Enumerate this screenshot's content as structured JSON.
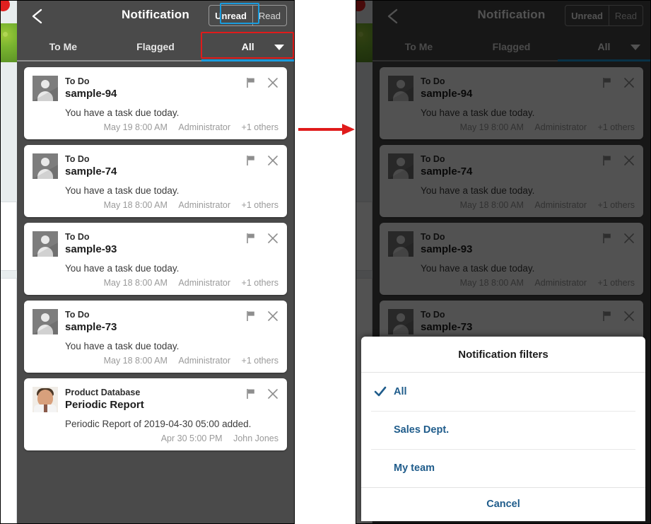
{
  "app": {
    "title": "Notification",
    "back_icon": "chevron-left-icon",
    "segmented": {
      "unread_label": "Unread",
      "read_label": "Read",
      "selected": "Unread"
    },
    "tabs": [
      {
        "label": "To Me",
        "active": false
      },
      {
        "label": "Flagged",
        "active": false
      },
      {
        "label": "All",
        "active": true,
        "has_caret": true
      }
    ]
  },
  "notifications": [
    {
      "kicker": "To Do",
      "title": "sample-94",
      "body": "You have a task due today.",
      "time": "May 19 8:00 AM",
      "author": "Administrator",
      "others": "+1 others",
      "avatar": "person-placeholder",
      "flag_icon": "flag-icon",
      "close_icon": "close-icon"
    },
    {
      "kicker": "To Do",
      "title": "sample-74",
      "body": "You have a task due today.",
      "time": "May 18 8:00 AM",
      "author": "Administrator",
      "others": "+1 others",
      "avatar": "person-placeholder",
      "flag_icon": "flag-icon",
      "close_icon": "close-icon"
    },
    {
      "kicker": "To Do",
      "title": "sample-93",
      "body": "You have a task due today.",
      "time": "May 18 8:00 AM",
      "author": "Administrator",
      "others": "+1 others",
      "avatar": "person-placeholder",
      "flag_icon": "flag-icon",
      "close_icon": "close-icon"
    },
    {
      "kicker": "To Do",
      "title": "sample-73",
      "body": "You have a task due today.",
      "time": "May 18 8:00 AM",
      "author": "Administrator",
      "others": "+1 others",
      "avatar": "person-placeholder",
      "flag_icon": "flag-icon",
      "close_icon": "close-icon"
    },
    {
      "kicker": "Product Database",
      "title": "Periodic Report",
      "body": "Periodic Report of 2019-04-30 05:00 added.",
      "time": "Apr 30 5:00 PM",
      "author": "John Jones",
      "others": "",
      "avatar": "user-photo",
      "flag_icon": "flag-icon",
      "close_icon": "close-icon"
    }
  ],
  "dialog": {
    "title": "Notification filters",
    "options": [
      {
        "label": "All",
        "checked": true
      },
      {
        "label": "Sales Dept.",
        "checked": false
      },
      {
        "label": "My team",
        "checked": false
      }
    ],
    "cancel_label": "Cancel",
    "check_icon": "check-icon"
  },
  "annotations": {
    "arrow_icon": "right-arrow-icon",
    "red_color": "#e01b1b",
    "blue_color": "#1a9bdc"
  },
  "colors": {
    "chrome": "#4a4a4a",
    "accent_blue": "#1a9bdc",
    "link_blue": "#1f5c8b",
    "card_bg": "#ffffff",
    "meta_gray": "#9a9a9a"
  }
}
